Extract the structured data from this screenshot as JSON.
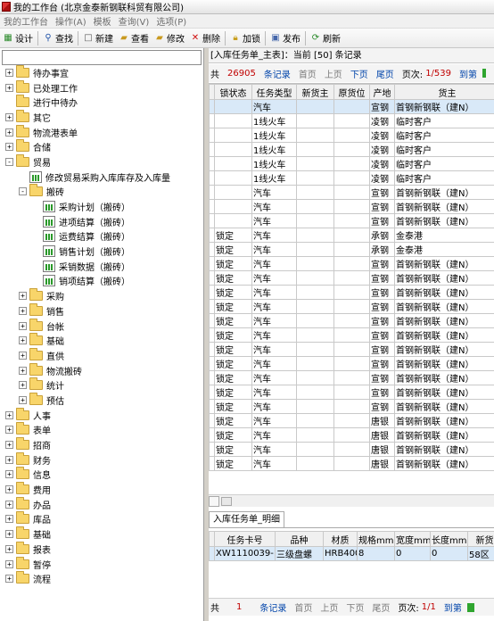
{
  "window": {
    "title": "我的工作台 (北京金泰新钢联科贸有限公司)"
  },
  "menu": [
    "我的工作台",
    "操作(A)",
    "模板",
    "查询(V)",
    "选项(P)"
  ],
  "toolbar": {
    "buttons": [
      {
        "label": "设计",
        "icon": "design-icon"
      },
      {
        "label": "查找",
        "icon": "find-icon"
      },
      {
        "label": "新建",
        "icon": "new-icon"
      },
      {
        "label": "查看",
        "icon": "view-icon"
      },
      {
        "label": "修改",
        "icon": "edit-icon"
      },
      {
        "label": "删除",
        "icon": "delete-icon"
      },
      {
        "label": "加锁",
        "icon": "lock-icon"
      },
      {
        "label": "发布",
        "icon": "publish-icon"
      },
      {
        "label": "刷新",
        "icon": "refresh-icon"
      }
    ]
  },
  "tree": [
    {
      "label": "待办事宜",
      "level": 0,
      "exp": "+",
      "icon": "folder"
    },
    {
      "label": "已处理工作",
      "level": 0,
      "exp": "+",
      "icon": "folder"
    },
    {
      "label": "进行中待办",
      "level": 0,
      "exp": "",
      "icon": "folder"
    },
    {
      "label": "其它",
      "level": 0,
      "exp": "+",
      "icon": "folder"
    },
    {
      "label": "物流港表单",
      "level": 0,
      "exp": "+",
      "icon": "folder"
    },
    {
      "label": "合储",
      "level": 0,
      "exp": "+",
      "icon": "folder"
    },
    {
      "label": "贸易",
      "level": 0,
      "exp": "-",
      "icon": "folder"
    },
    {
      "label": "修改贸易采购入库库存及入库量",
      "level": 1,
      "exp": "",
      "icon": "report"
    },
    {
      "label": "搬砖",
      "level": 1,
      "exp": "-",
      "icon": "folder"
    },
    {
      "label": "采购计划（搬砖）",
      "level": 2,
      "exp": "",
      "icon": "report"
    },
    {
      "label": "进项结算（搬砖）",
      "level": 2,
      "exp": "",
      "icon": "report"
    },
    {
      "label": "运费结算（搬砖）",
      "level": 2,
      "exp": "",
      "icon": "report"
    },
    {
      "label": "销售计划（搬砖）",
      "level": 2,
      "exp": "",
      "icon": "report"
    },
    {
      "label": "采销数据（搬砖）",
      "level": 2,
      "exp": "",
      "icon": "report"
    },
    {
      "label": "销项结算（搬砖）",
      "level": 2,
      "exp": "",
      "icon": "report"
    },
    {
      "label": "采购",
      "level": 1,
      "exp": "+",
      "icon": "folder"
    },
    {
      "label": "销售",
      "level": 1,
      "exp": "+",
      "icon": "folder"
    },
    {
      "label": "台帐",
      "level": 1,
      "exp": "+",
      "icon": "folder"
    },
    {
      "label": "基础",
      "level": 1,
      "exp": "+",
      "icon": "folder"
    },
    {
      "label": "直供",
      "level": 1,
      "exp": "+",
      "icon": "folder"
    },
    {
      "label": "物流搬砖",
      "level": 1,
      "exp": "+",
      "icon": "folder"
    },
    {
      "label": "统计",
      "level": 1,
      "exp": "+",
      "icon": "folder"
    },
    {
      "label": "预估",
      "level": 1,
      "exp": "+",
      "icon": "folder"
    },
    {
      "label": "人事",
      "level": 0,
      "exp": "+",
      "icon": "folder"
    },
    {
      "label": "表单",
      "level": 0,
      "exp": "+",
      "icon": "folder"
    },
    {
      "label": "招商",
      "level": 0,
      "exp": "+",
      "icon": "folder"
    },
    {
      "label": "财务",
      "level": 0,
      "exp": "+",
      "icon": "folder"
    },
    {
      "label": "信息",
      "level": 0,
      "exp": "+",
      "icon": "folder"
    },
    {
      "label": "费用",
      "level": 0,
      "exp": "+",
      "icon": "folder"
    },
    {
      "label": "办品",
      "level": 0,
      "exp": "+",
      "icon": "folder"
    },
    {
      "label": "库品",
      "level": 0,
      "exp": "+",
      "icon": "folder"
    },
    {
      "label": "基础",
      "level": 0,
      "exp": "+",
      "icon": "folder"
    },
    {
      "label": "报表",
      "level": 0,
      "exp": "+",
      "icon": "folder"
    },
    {
      "label": "暂停",
      "level": 0,
      "exp": "+",
      "icon": "folder"
    },
    {
      "label": "流程",
      "level": 0,
      "exp": "+",
      "icon": "folder"
    }
  ],
  "master": {
    "header": "[入库任务单_主表]：当前 [50] 条记录",
    "pager": {
      "prefix": "共",
      "count": "26905",
      "unit": "条记录",
      "first": "首页",
      "prev": "上页",
      "next": "下页",
      "last": "尾页",
      "page_label": "页次:",
      "page": "1/539",
      "go": "到第"
    },
    "columns": [
      "锁状态",
      "任务类型",
      "新货主",
      "原货位",
      "产地",
      "货主"
    ],
    "rows": [
      [
        "",
        "汽车",
        "",
        "",
        "宣钢",
        "首钢新钢联（建N）"
      ],
      [
        "",
        "1线火车",
        "",
        "",
        "凌钢",
        "临时客户"
      ],
      [
        "",
        "1线火车",
        "",
        "",
        "凌钢",
        "临时客户"
      ],
      [
        "",
        "1线火车",
        "",
        "",
        "凌钢",
        "临时客户"
      ],
      [
        "",
        "1线火车",
        "",
        "",
        "凌钢",
        "临时客户"
      ],
      [
        "",
        "1线火车",
        "",
        "",
        "凌钢",
        "临时客户"
      ],
      [
        "",
        "汽车",
        "",
        "",
        "宣钢",
        "首钢新钢联（建N）"
      ],
      [
        "",
        "汽车",
        "",
        "",
        "宣钢",
        "首钢新钢联（建N）"
      ],
      [
        "",
        "汽车",
        "",
        "",
        "宣钢",
        "首钢新钢联（建N）"
      ],
      [
        "锁定",
        "汽车",
        "",
        "",
        "承钢",
        "金泰港"
      ],
      [
        "锁定",
        "汽车",
        "",
        "",
        "承钢",
        "金泰港"
      ],
      [
        "锁定",
        "汽车",
        "",
        "",
        "宣钢",
        "首钢新钢联（建N）"
      ],
      [
        "锁定",
        "汽车",
        "",
        "",
        "宣钢",
        "首钢新钢联（建N）"
      ],
      [
        "锁定",
        "汽车",
        "",
        "",
        "宣钢",
        "首钢新钢联（建N）"
      ],
      [
        "锁定",
        "汽车",
        "",
        "",
        "宣钢",
        "首钢新钢联（建N）"
      ],
      [
        "锁定",
        "汽车",
        "",
        "",
        "宣钢",
        "首钢新钢联（建N）"
      ],
      [
        "锁定",
        "汽车",
        "",
        "",
        "宣钢",
        "首钢新钢联（建N）"
      ],
      [
        "锁定",
        "汽车",
        "",
        "",
        "宣钢",
        "首钢新钢联（建N）"
      ],
      [
        "锁定",
        "汽车",
        "",
        "",
        "宣钢",
        "首钢新钢联（建N）"
      ],
      [
        "锁定",
        "汽车",
        "",
        "",
        "宣钢",
        "首钢新钢联（建N）"
      ],
      [
        "锁定",
        "汽车",
        "",
        "",
        "宣钢",
        "首钢新钢联（建N）"
      ],
      [
        "锁定",
        "汽车",
        "",
        "",
        "宣钢",
        "首钢新钢联（建N）"
      ],
      [
        "锁定",
        "汽车",
        "",
        "",
        "唐银",
        "首钢新钢联（建N）"
      ],
      [
        "锁定",
        "汽车",
        "",
        "",
        "唐银",
        "首钢新钢联（建N）"
      ],
      [
        "锁定",
        "汽车",
        "",
        "",
        "唐银",
        "首钢新钢联（建N）"
      ],
      [
        "锁定",
        "汽车",
        "",
        "",
        "唐银",
        "首钢新钢联（建N）"
      ]
    ]
  },
  "detail": {
    "tab": "入库任务单_明细",
    "columns": [
      "任务卡号",
      "品种",
      "材质",
      "规格mm",
      "宽度mm",
      "长度mm",
      "新货"
    ],
    "rows": [
      [
        "XW1110039-1",
        "三级盘螺",
        "HRB400",
        "8",
        "0",
        "0",
        "58区"
      ]
    ],
    "pager": {
      "prefix": "共",
      "count": "1",
      "unit": "条记录",
      "first": "首页",
      "prev": "上页",
      "next": "下页",
      "last": "尾页",
      "page_label": "页次:",
      "page": "1/1",
      "go": "到第"
    }
  }
}
